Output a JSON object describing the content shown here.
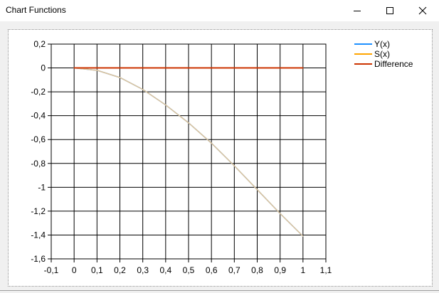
{
  "window": {
    "title": "Chart Functions",
    "minimize_icon": "minimize-icon",
    "maximize_icon": "maximize-icon",
    "close_icon": "close-icon"
  },
  "chart_data": {
    "type": "line",
    "title": "",
    "xlabel": "",
    "ylabel": "",
    "xlim": [
      -0.1,
      1.1
    ],
    "ylim": [
      -1.6,
      0.2
    ],
    "x_ticks": [
      "-0,1",
      "0",
      "0,1",
      "0,2",
      "0,3",
      "0,4",
      "0,5",
      "0,6",
      "0,7",
      "0,8",
      "0,9",
      "1",
      "1,1"
    ],
    "y_ticks": [
      "0,2",
      "0",
      "-0,2",
      "-0,4",
      "-0,6",
      "-0,8",
      "-1",
      "-1,2",
      "-1,4",
      "-1,6"
    ],
    "grid": true,
    "legend_position": "top-right",
    "series": [
      {
        "name": "Y(x)",
        "color": "#1e90ff",
        "x": [
          0,
          0.1,
          0.2,
          0.3,
          0.4,
          0.5,
          0.6,
          0.7,
          0.8,
          0.9,
          1.0
        ],
        "y": [
          0,
          -0.02,
          -0.08,
          -0.18,
          -0.31,
          -0.46,
          -0.63,
          -0.82,
          -1.02,
          -1.22,
          -1.41
        ]
      },
      {
        "name": "S(x)",
        "color": "#ffa500",
        "x": [
          0,
          0.1,
          0.2,
          0.3,
          0.4,
          0.5,
          0.6,
          0.7,
          0.8,
          0.9,
          1.0
        ],
        "y": [
          0,
          -0.02,
          -0.08,
          -0.18,
          -0.31,
          -0.46,
          -0.63,
          -0.82,
          -1.02,
          -1.22,
          -1.41
        ]
      },
      {
        "name": "Difference",
        "color": "#cc3300",
        "x": [
          0,
          0.1,
          0.2,
          0.3,
          0.4,
          0.5,
          0.6,
          0.7,
          0.8,
          0.9,
          1.0
        ],
        "y": [
          0,
          0,
          0,
          0,
          0,
          0,
          0,
          0,
          0,
          0,
          0
        ]
      }
    ]
  }
}
